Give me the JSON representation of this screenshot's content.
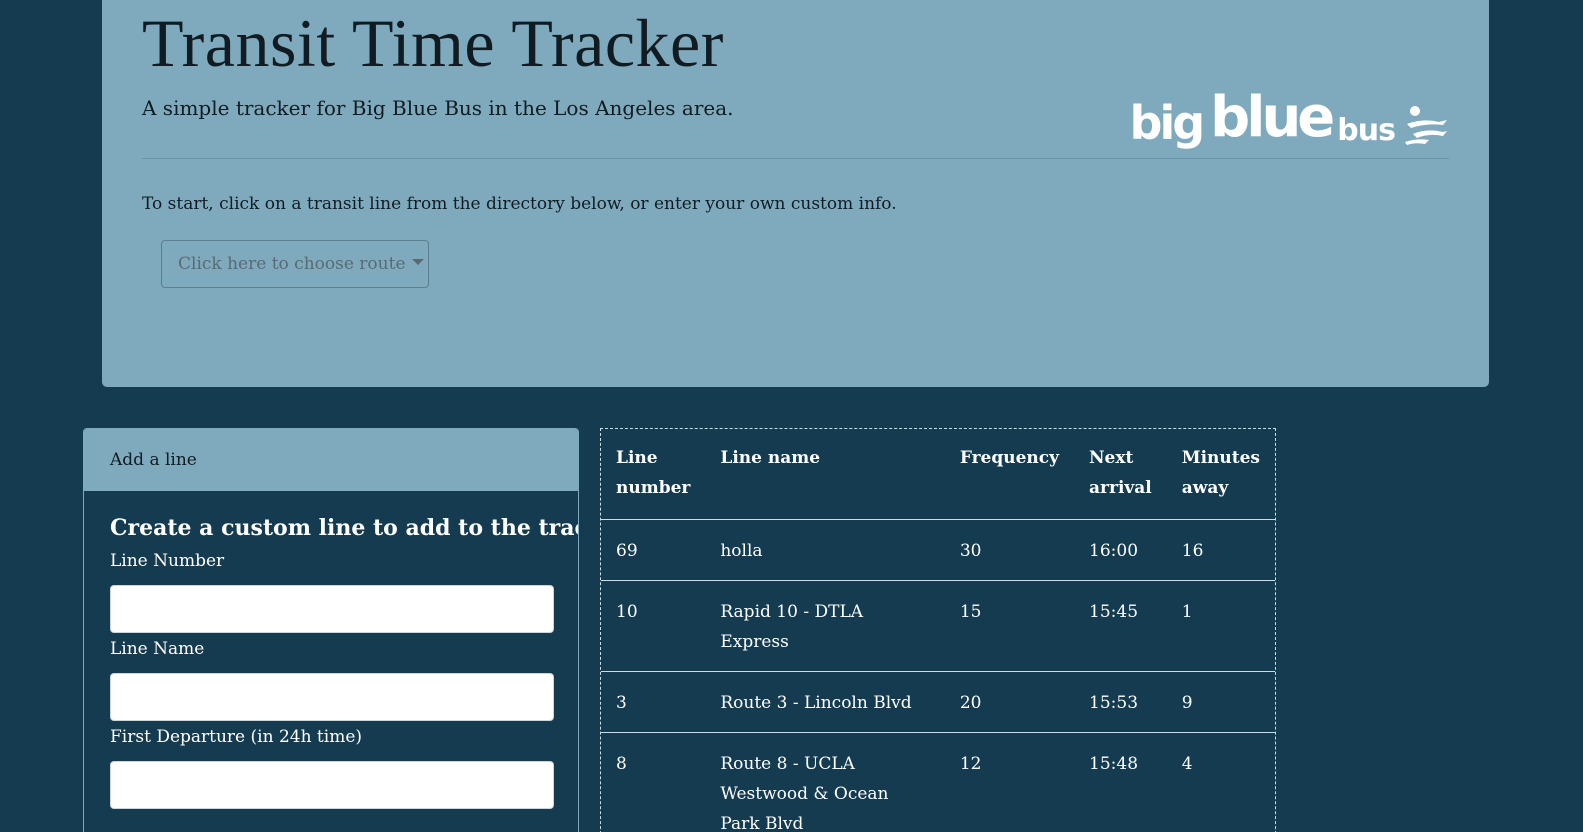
{
  "header": {
    "title": "Transit Time Tracker",
    "subtitle": "A simple tracker for Big Blue Bus in the Los Angeles area.",
    "logo": {
      "word1": "big",
      "word2": "blue",
      "word3": "bus"
    },
    "instruction": "To start, click on a transit line from the directory below, or enter your own custom info.",
    "route_dropdown": "Click here to choose route"
  },
  "add_line": {
    "header": "Add a line",
    "title": "Create a custom line to add to the tracker:",
    "line_number_label": "Line Number",
    "line_name_label": "Line Name",
    "first_departure_label": "First Departure (in 24h time)"
  },
  "table": {
    "headers": [
      "Line number",
      "Line name",
      "Frequency",
      "Next arrival",
      "Minutes away"
    ],
    "rows": [
      [
        "69",
        "holla",
        "30",
        "16:00",
        "16"
      ],
      [
        "10",
        "Rapid 10 - DTLA Express",
        "15",
        "15:45",
        "1"
      ],
      [
        "3",
        "Route 3 - Lincoln Blvd",
        "20",
        "15:53",
        "9"
      ],
      [
        "8",
        "Route 8 - UCLA Westwood & Ocean Park Blvd",
        "12",
        "15:48",
        "4"
      ]
    ]
  },
  "colors": {
    "background": "#143b4f",
    "jumbotron": "#7faabd",
    "text_dark": "#111c22"
  }
}
